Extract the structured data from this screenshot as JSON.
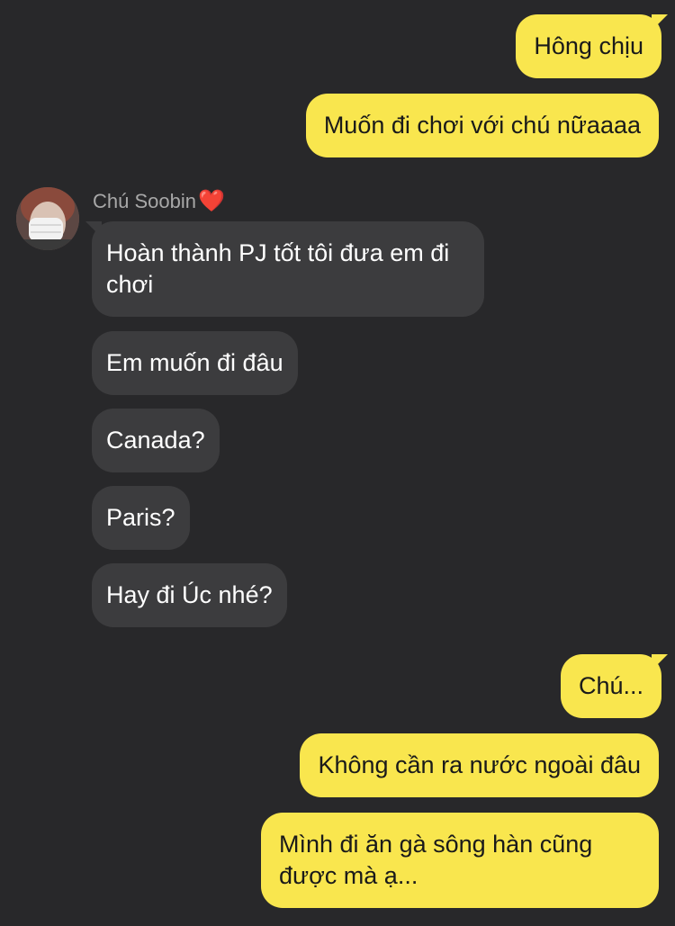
{
  "chat": {
    "sender_name": "Chú Soobin",
    "sender_badge": "❤️",
    "messages": [
      {
        "from": "me",
        "text": "Hông chịu"
      },
      {
        "from": "me",
        "text": "Muốn đi chơi với chú nữaaaa"
      },
      {
        "from": "other",
        "text": "Hoàn thành PJ tốt tôi đưa em đi chơi"
      },
      {
        "from": "other",
        "text": "Em muốn đi đâu"
      },
      {
        "from": "other",
        "text": "Canada?"
      },
      {
        "from": "other",
        "text": "Paris?"
      },
      {
        "from": "other",
        "text": "Hay đi Úc nhé?"
      },
      {
        "from": "me",
        "text": "Chú..."
      },
      {
        "from": "me",
        "text": "Không cần ra nước ngoài đâu"
      },
      {
        "from": "me",
        "text": "Mình đi ăn gà sông hàn cũng được mà ạ..."
      }
    ]
  },
  "colors": {
    "background": "#28282a",
    "my_bubble": "#f9e64e",
    "their_bubble": "#3c3c3e",
    "sender_name": "#a8a8a8"
  }
}
